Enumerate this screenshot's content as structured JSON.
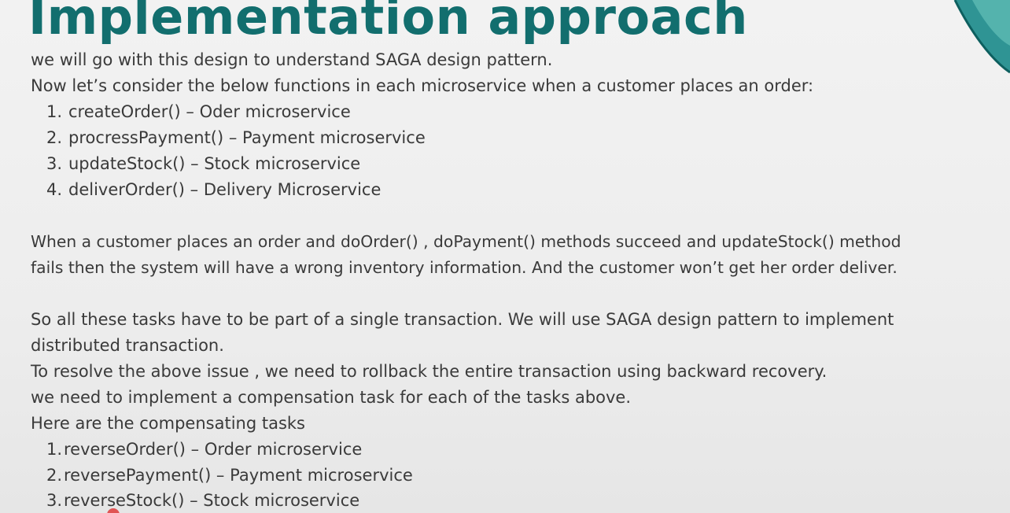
{
  "title": "Implementation approach",
  "intro": [
    "we will go with this design to understand SAGA design pattern.",
    "Now let’s consider the below functions in each microservice when a customer places an order:"
  ],
  "functions": [
    {
      "num": "1.",
      "text": "createOrder() – Oder microservice"
    },
    {
      "num": "2.",
      "text": "procressPayment() – Payment microservice"
    },
    {
      "num": "3.",
      "text": "updateStock() – Stock microservice"
    },
    {
      "num": "4.",
      "text": "deliverOrder() – Delivery Microservice"
    }
  ],
  "problem": [
    "When a customer places an order and doOrder() , doPayment() methods succeed and updateStock() method",
    "fails then the system will have a wrong inventory information. And the customer won’t get her order deliver."
  ],
  "solution": [
    "So all these tasks have to be part of a single transaction. We will use SAGA design pattern to implement",
    "distributed transaction.",
    "To resolve the above issue , we need to rollback the entire transaction using backward recovery.",
    "we need to implement a compensation task for each of the tasks above.",
    "Here are the compensating tasks"
  ],
  "compensations": [
    {
      "num": "1.",
      "text": "reverseOrder() – Order microservice"
    },
    {
      "num": "2.",
      "text": "reversePayment() – Payment microservice"
    },
    {
      "num": "3.",
      "text": "reverseStock() – Stock microservice"
    }
  ],
  "colors": {
    "title": "#126e6e",
    "text": "#3a3a3a",
    "accent": "#1a8a8a",
    "background": "#f0f0f0"
  }
}
